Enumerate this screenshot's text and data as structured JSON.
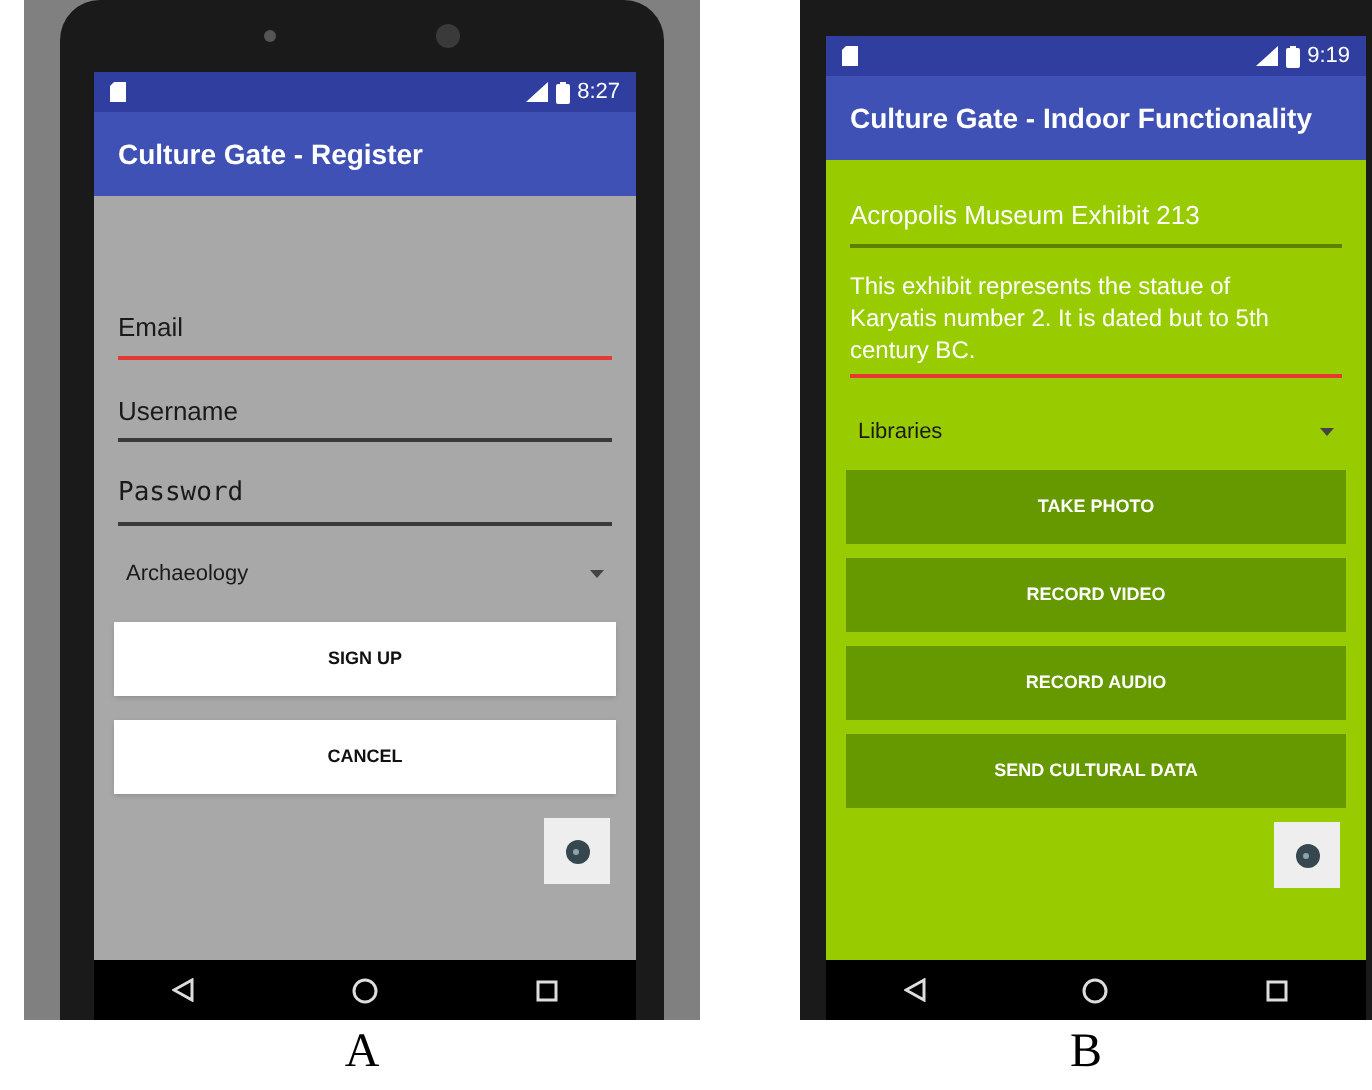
{
  "panels": [
    {
      "caption": "A",
      "kind": "gray",
      "status_time": "8:27",
      "title": "Culture Gate - Register",
      "items": [
        {
          "kind": "field",
          "placeholder": "Email",
          "focused": true
        },
        {
          "kind": "field",
          "placeholder": "Username",
          "focused": false
        },
        {
          "kind": "password",
          "placeholder": "Password",
          "focused": false
        },
        {
          "kind": "dropdown",
          "value": "Archaeology"
        },
        {
          "kind": "button",
          "label": "SIGN UP"
        },
        {
          "kind": "button",
          "label": "CANCEL"
        },
        {
          "kind": "fab"
        }
      ]
    },
    {
      "caption": "B",
      "kind": "green",
      "status_time": "9:19",
      "title": "Culture Gate - Indoor Functionality",
      "items": [
        {
          "kind": "field",
          "value": "Acropolis Museum Exhibit 213",
          "focused": false
        },
        {
          "kind": "multiline",
          "value": "This exhibit represents the statue of Karyatis number 2. It is dated but to 5th century BC.",
          "focused": true
        },
        {
          "kind": "dropdown",
          "value": "Libraries"
        },
        {
          "kind": "button",
          "label": "TAKE PHOTO"
        },
        {
          "kind": "button",
          "label": "RECORD VIDEO"
        },
        {
          "kind": "button",
          "label": "RECORD AUDIO"
        },
        {
          "kind": "button",
          "label": "SEND CULTURAL DATA"
        },
        {
          "kind": "fab"
        }
      ]
    }
  ]
}
